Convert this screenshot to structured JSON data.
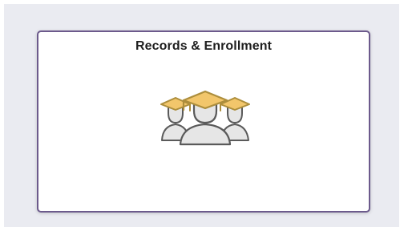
{
  "tile": {
    "title": "Records & Enrollment",
    "icon": "graduates-icon"
  },
  "colors": {
    "page_background": "#eaebf1",
    "tile_border": "#6c5a8c",
    "cap_gold": "#f2c66b",
    "cap_outline": "#ad8e3c",
    "figure_outline": "#5a5a5a",
    "figure_fill": "#e6e6e6"
  }
}
